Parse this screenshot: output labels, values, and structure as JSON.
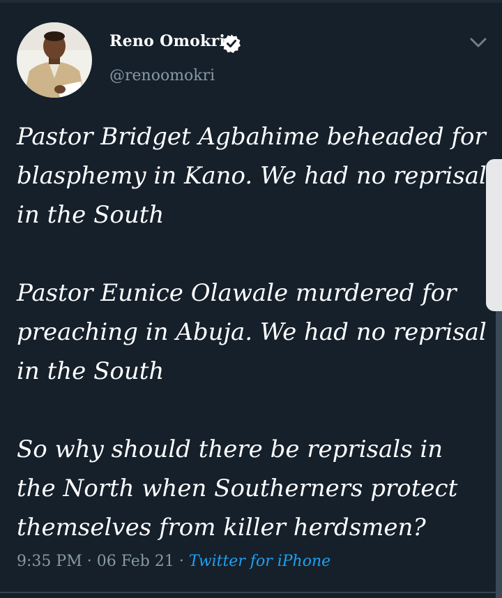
{
  "tweet": {
    "author": {
      "display_name": "Reno Omokri",
      "handle": "@renoomokri",
      "verified": true
    },
    "paragraphs": [
      [
        "Pastor Bridget Agbahime beheaded for",
        "blasphemy in Kano. We had no reprisal",
        "in the South"
      ],
      [
        "Pastor Eunice Olawale murdered for",
        "preaching in Abuja. We had no reprisal",
        "in the South"
      ],
      [
        "So why should there be reprisals in",
        "the North when Southerners protect",
        "themselves from killer herdsmen?"
      ]
    ],
    "time": "9:35 PM",
    "date": "06 Feb 21",
    "separator": " · ",
    "source": "Twitter for iPhone"
  },
  "icons": {
    "verified": "verified-badge-icon",
    "more": "chevron-down-icon"
  },
  "colors": {
    "background": "#15202b",
    "text": "#ffffff",
    "secondary": "#8899a6",
    "link": "#1da1f2"
  }
}
